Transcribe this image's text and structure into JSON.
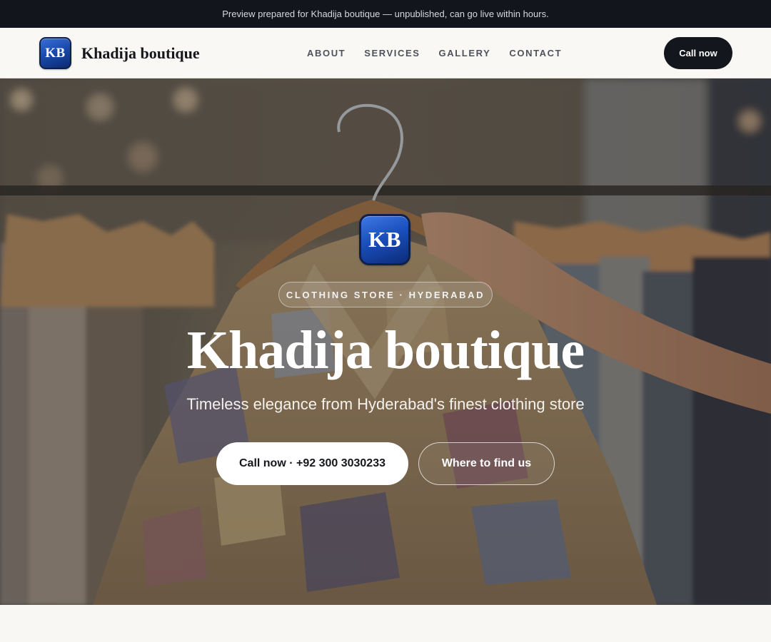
{
  "preview_banner": {
    "text": "Preview prepared for Khadija boutique — unpublished, can go live within hours."
  },
  "header": {
    "logo_initials": "KB",
    "brand_name": "Khadija boutique",
    "nav": [
      {
        "label": "ABOUT"
      },
      {
        "label": "SERVICES"
      },
      {
        "label": "GALLERY"
      },
      {
        "label": "CONTACT"
      }
    ],
    "cta_label": "Call now"
  },
  "hero": {
    "logo_initials": "KB",
    "tag": "CLOTHING STORE · HYDERABAD",
    "title": "Khadija boutique",
    "subtitle": "Timeless elegance from Hyderabad's finest clothing store",
    "primary_button": "Call now · +92 300 3030233",
    "secondary_button": "Where to find us"
  },
  "colors": {
    "dark": "#12151b",
    "logo_blue": "#1a4bb0",
    "page_bg": "#f8f7f4"
  }
}
